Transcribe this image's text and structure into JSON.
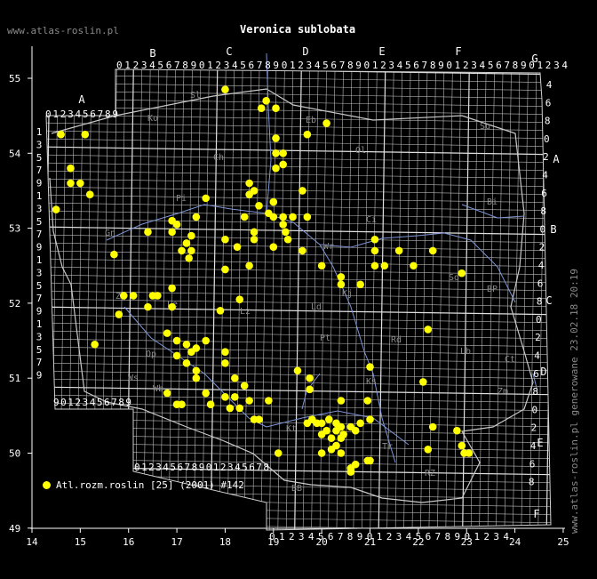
{
  "header": {
    "site": "www.atlas-roslin.pl",
    "title": "Veronica sublobata"
  },
  "side_credit": "www.atlas-roslin.pl generowane 23.02.18 20:19",
  "legend": {
    "label": "Atl.rozm.roslin [25] (2001) #142",
    "marker_color": "#ffff00"
  },
  "axes": {
    "x_ticks": [
      "14",
      "15",
      "16",
      "17",
      "18",
      "19",
      "20",
      "21",
      "22",
      "23",
      "24",
      "25"
    ],
    "y_ticks": [
      "55",
      "54",
      "53",
      "52",
      "51",
      "50",
      "49"
    ]
  },
  "grid": {
    "column_letters": [
      "A",
      "B",
      "C",
      "D",
      "E",
      "F",
      "G"
    ],
    "row_letters": [
      "A",
      "B",
      "C",
      "D",
      "E",
      "F",
      "G"
    ],
    "top_digits_B_to_G": "0123456789012345678901234567890123456789012345678901234",
    "top_digits_A": "0123456789",
    "bottom_digits_left": "0123456789012345678",
    "bottom_digits_right": "0123456789012345678901234",
    "left_digits": [
      "1",
      "3",
      "5",
      "7",
      "9",
      "1",
      "3",
      "5",
      "7",
      "9",
      "1",
      "3",
      "5",
      "7",
      "9",
      "1",
      "3",
      "5",
      "7",
      "9"
    ],
    "lower_left_digits": "90123456789",
    "right_digits": [
      "4",
      "6",
      "8",
      "0",
      "2",
      "4",
      "6",
      "8",
      "0",
      "2",
      "4",
      "6",
      "8",
      "0",
      "2",
      "4",
      "6",
      "8",
      "0",
      "2",
      "4",
      "6",
      "8"
    ]
  },
  "region_codes": [
    "Sl",
    "Ko",
    "Eb",
    "Su",
    "Ch",
    "Ol",
    "Pi",
    "Bi",
    "Gn",
    "Ci",
    "Wr",
    "Kj",
    "Sd",
    "Zg",
    "Le",
    "Ld",
    "BP",
    "Lz",
    "Pt",
    "Rd",
    "Lb",
    "Op",
    "Ws",
    "Wb",
    "Ks",
    "Zm",
    "Ct",
    "Kt",
    "Tr",
    "RZ",
    "BB"
  ],
  "colors": {
    "background": "#000000",
    "grid": "#b8b8b8",
    "rivers": "#7d95d6",
    "border": "#c8c8c8",
    "marker": "#ffff00"
  },
  "points": [
    [
      18.0,
      54.85
    ],
    [
      18.75,
      54.6
    ],
    [
      18.85,
      54.7
    ],
    [
      19.05,
      54.6
    ],
    [
      14.6,
      54.25
    ],
    [
      15.1,
      54.25
    ],
    [
      19.05,
      54.2
    ],
    [
      19.7,
      54.25
    ],
    [
      20.1,
      54.4
    ],
    [
      19.05,
      54.0
    ],
    [
      19.2,
      54.0
    ],
    [
      19.2,
      53.85
    ],
    [
      19.05,
      53.8
    ],
    [
      14.8,
      53.8
    ],
    [
      14.8,
      53.6
    ],
    [
      15.0,
      53.6
    ],
    [
      15.2,
      53.45
    ],
    [
      18.5,
      53.6
    ],
    [
      18.6,
      53.5
    ],
    [
      18.5,
      53.45
    ],
    [
      18.7,
      53.3
    ],
    [
      19.0,
      53.35
    ],
    [
      18.9,
      53.2
    ],
    [
      19.6,
      53.5
    ],
    [
      19.0,
      53.15
    ],
    [
      19.2,
      53.15
    ],
    [
      19.4,
      53.15
    ],
    [
      19.7,
      53.15
    ],
    [
      14.5,
      53.25
    ],
    [
      17.6,
      53.4
    ],
    [
      18.4,
      53.15
    ],
    [
      17.4,
      53.15
    ],
    [
      16.9,
      53.1
    ],
    [
      17.0,
      53.05
    ],
    [
      16.9,
      52.95
    ],
    [
      16.4,
      52.95
    ],
    [
      18.0,
      52.85
    ],
    [
      18.6,
      52.95
    ],
    [
      18.6,
      52.85
    ],
    [
      19.2,
      53.05
    ],
    [
      19.25,
      52.95
    ],
    [
      19.3,
      52.85
    ],
    [
      18.25,
      52.75
    ],
    [
      19.0,
      52.75
    ],
    [
      17.3,
      52.9
    ],
    [
      17.2,
      52.8
    ],
    [
      17.1,
      52.7
    ],
    [
      17.3,
      52.7
    ],
    [
      17.25,
      52.6
    ],
    [
      15.7,
      52.65
    ],
    [
      19.6,
      52.7
    ],
    [
      20.0,
      52.5
    ],
    [
      21.1,
      52.85
    ],
    [
      21.1,
      52.7
    ],
    [
      21.1,
      52.5
    ],
    [
      21.3,
      52.5
    ],
    [
      21.6,
      52.7
    ],
    [
      21.9,
      52.5
    ],
    [
      22.3,
      52.7
    ],
    [
      22.9,
      52.4
    ],
    [
      18.5,
      52.5
    ],
    [
      18.0,
      52.45
    ],
    [
      20.4,
      52.35
    ],
    [
      20.4,
      52.25
    ],
    [
      20.8,
      52.25
    ],
    [
      16.9,
      52.2
    ],
    [
      15.9,
      52.1
    ],
    [
      16.1,
      52.1
    ],
    [
      16.5,
      52.1
    ],
    [
      16.6,
      52.1
    ],
    [
      18.3,
      52.05
    ],
    [
      16.9,
      51.95
    ],
    [
      16.4,
      51.95
    ],
    [
      17.9,
      51.9
    ],
    [
      15.8,
      51.85
    ],
    [
      16.8,
      51.6
    ],
    [
      17.0,
      51.5
    ],
    [
      17.6,
      51.5
    ],
    [
      15.3,
      51.45
    ],
    [
      17.2,
      51.45
    ],
    [
      17.4,
      51.4
    ],
    [
      17.3,
      51.35
    ],
    [
      18.0,
      51.35
    ],
    [
      17.0,
      51.3
    ],
    [
      17.2,
      51.2
    ],
    [
      18.0,
      51.2
    ],
    [
      17.4,
      51.1
    ],
    [
      17.4,
      51.0
    ],
    [
      19.5,
      51.1
    ],
    [
      19.75,
      51.0
    ],
    [
      21.0,
      51.15
    ],
    [
      22.2,
      51.65
    ],
    [
      22.1,
      50.95
    ],
    [
      18.2,
      51.0
    ],
    [
      18.4,
      50.9
    ],
    [
      16.8,
      50.8
    ],
    [
      17.6,
      50.8
    ],
    [
      18.0,
      50.75
    ],
    [
      18.2,
      50.75
    ],
    [
      18.5,
      50.7
    ],
    [
      18.9,
      50.7
    ],
    [
      17.7,
      50.65
    ],
    [
      18.1,
      50.6
    ],
    [
      18.3,
      50.6
    ],
    [
      17.0,
      50.65
    ],
    [
      17.1,
      50.65
    ],
    [
      18.6,
      50.45
    ],
    [
      18.7,
      50.45
    ],
    [
      19.75,
      50.85
    ],
    [
      20.4,
      50.7
    ],
    [
      20.95,
      50.7
    ],
    [
      19.8,
      50.45
    ],
    [
      19.7,
      50.4
    ],
    [
      19.9,
      50.4
    ],
    [
      20.0,
      50.4
    ],
    [
      20.15,
      50.45
    ],
    [
      20.3,
      50.4
    ],
    [
      20.4,
      50.35
    ],
    [
      20.1,
      50.3
    ],
    [
      20.3,
      50.3
    ],
    [
      20.45,
      50.25
    ],
    [
      20.6,
      50.35
    ],
    [
      20.8,
      50.4
    ],
    [
      21.0,
      50.45
    ],
    [
      20.7,
      50.3
    ],
    [
      20.0,
      50.25
    ],
    [
      20.2,
      50.2
    ],
    [
      20.4,
      50.2
    ],
    [
      20.3,
      50.1
    ],
    [
      20.0,
      50.0
    ],
    [
      20.4,
      50.0
    ],
    [
      19.1,
      50.0
    ],
    [
      20.2,
      50.05
    ],
    [
      22.3,
      50.35
    ],
    [
      22.8,
      50.3
    ],
    [
      22.2,
      50.05
    ],
    [
      22.9,
      50.1
    ],
    [
      22.95,
      50.0
    ],
    [
      23.05,
      50.0
    ],
    [
      20.95,
      49.9
    ],
    [
      21.0,
      49.9
    ],
    [
      20.7,
      49.85
    ],
    [
      20.6,
      49.8
    ],
    [
      20.6,
      49.75
    ]
  ]
}
